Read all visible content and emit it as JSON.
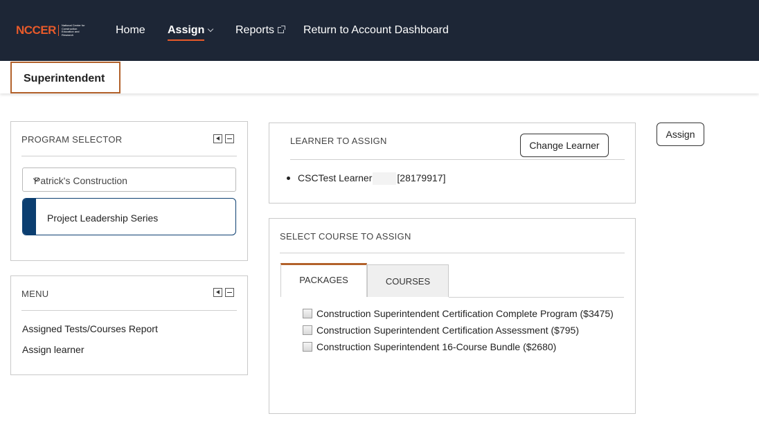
{
  "header": {
    "logo": {
      "word": "NCCER",
      "tagline": "National Center for Construction Education and Research"
    },
    "nav": {
      "home": "Home",
      "assign": "Assign",
      "reports": "Reports",
      "return": "Return to Account Dashboard"
    }
  },
  "role": "Superintendent",
  "program_selector": {
    "title": "PROGRAM SELECTOR",
    "selected_company": "Patrick's Construction",
    "program": "Project Leadership Series"
  },
  "menu": {
    "title": "MENU",
    "items": [
      "Assigned Tests/Courses Report",
      "Assign learner"
    ]
  },
  "learner": {
    "title": "LEARNER TO ASSIGN",
    "change_button": "Change Learner",
    "name": "CSCTest Learner",
    "id": "[28179917]"
  },
  "assign_button": "Assign",
  "course_select": {
    "title": "SELECT COURSE TO ASSIGN",
    "tabs": [
      "PACKAGES",
      "COURSES"
    ],
    "active_tab": "PACKAGES",
    "packages": [
      "Construction Superintendent Certification Complete Program ($3475)",
      "Construction Superintendent Certification Assessment ($795)",
      "Construction Superintendent 16-Course Bundle ($2680)"
    ]
  },
  "colors": {
    "nav_bg": "#1d2636",
    "accent_orange": "#e85a2a",
    "role_border": "#b2612a",
    "program_blue": "#0b3e70"
  }
}
